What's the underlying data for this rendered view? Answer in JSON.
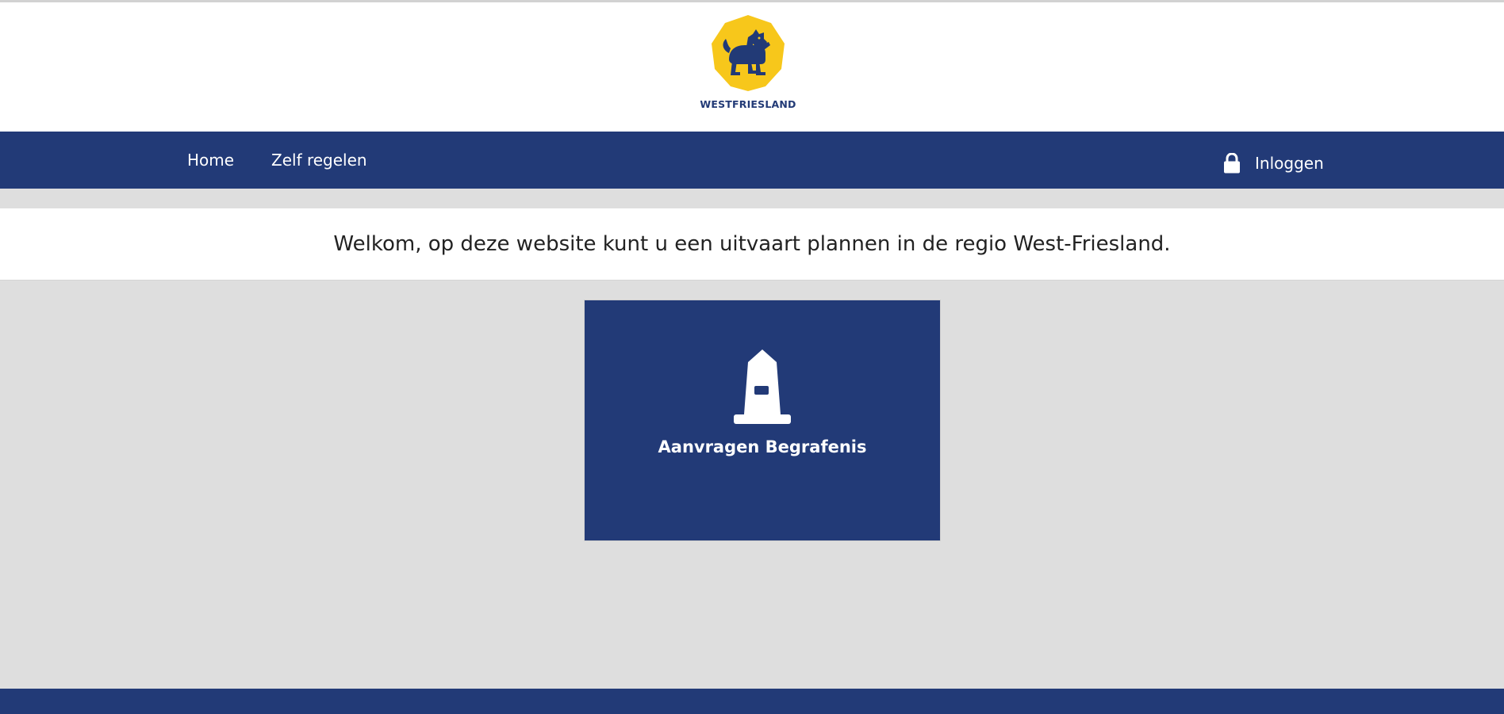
{
  "header": {
    "logo_text": "WESTFRIESLAND",
    "logo_icon": "westfriesland-lion-crest-icon"
  },
  "nav": {
    "items": [
      {
        "label": "Home"
      },
      {
        "label": "Zelf regelen"
      }
    ],
    "login_label": "Inloggen",
    "login_icon": "lock-icon"
  },
  "main": {
    "welcome": "Welkom, op deze website kunt u een uitvaart plannen in de regio West-Friesland.",
    "tiles": [
      {
        "label": "Aanvragen Begrafenis",
        "icon": "gravestone-icon"
      }
    ]
  },
  "colors": {
    "brand_blue": "#223a77",
    "brand_yellow": "#f7c71b",
    "background_gray": "#dedede",
    "white": "#ffffff"
  }
}
